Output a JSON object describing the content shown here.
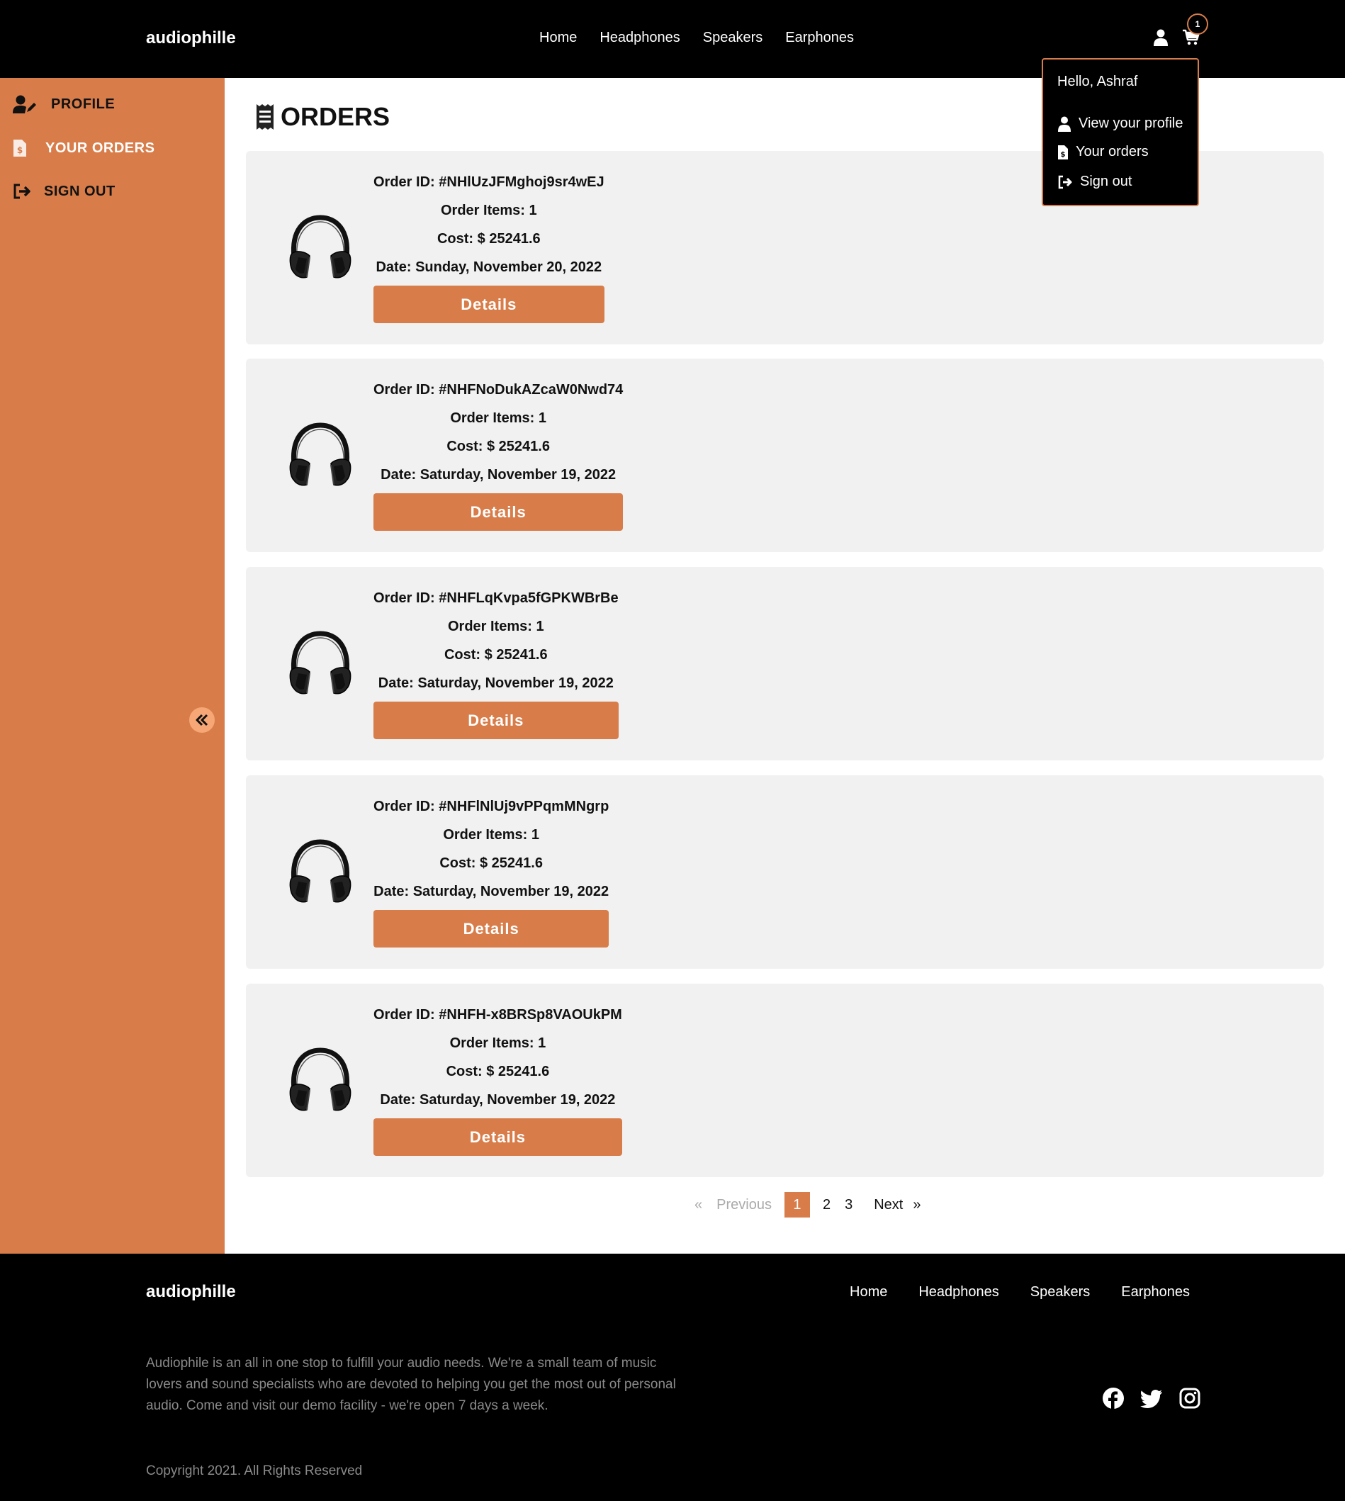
{
  "header": {
    "logo": "audiophille",
    "nav": [
      "Home",
      "Headphones",
      "Speakers",
      "Earphones"
    ],
    "cart_count": "1"
  },
  "dropdown": {
    "greeting": "Hello, Ashraf",
    "items": [
      "View your profile",
      "Your orders",
      "Sign out"
    ]
  },
  "sidebar": {
    "items": [
      "PROFILE",
      "YOUR ORDERS",
      "SIGN OUT"
    ]
  },
  "main": {
    "title": "ORDERS",
    "labels": {
      "order_id": "Order ID:",
      "order_items": "Order Items:",
      "cost": "Cost:",
      "date": "Date:",
      "details": "Details"
    },
    "orders": [
      {
        "id": "#NHlUzJFMghoj9sr4wEJ",
        "items": "1",
        "cost": "$ 25241.6",
        "date": "Sunday, November 20, 2022"
      },
      {
        "id": "#NHFNoDukAZcaW0Nwd74",
        "items": "1",
        "cost": "$ 25241.6",
        "date": "Saturday, November 19, 2022"
      },
      {
        "id": "#NHFLqKvpa5fGPKWBrBe",
        "items": "1",
        "cost": "$ 25241.6",
        "date": "Saturday, November 19, 2022"
      },
      {
        "id": "#NHFlNlUj9vPPqmMNgrp",
        "items": "1",
        "cost": "$ 25241.6",
        "date": "Saturday, November 19, 2022"
      },
      {
        "id": "#NHFH-x8BRSp8VAOUkPM",
        "items": "1",
        "cost": "$ 25241.6",
        "date": "Saturday, November 19, 2022"
      }
    ]
  },
  "pagination": {
    "prev_arrow": "«",
    "previous": "Previous",
    "pages": [
      "1",
      "2",
      "3"
    ],
    "current": "1",
    "next": "Next",
    "next_arrow": "»"
  },
  "footer": {
    "logo": "audiophille",
    "nav": [
      "Home",
      "Headphones",
      "Speakers",
      "Earphones"
    ],
    "description": "Audiophile is an all in one stop to fulfill your audio needs. We're a small team of music lovers and sound specialists who are devoted to helping you get the most out of personal audio. Come and visit our demo facility - we're open 7 days a week.",
    "copyright": "Copyright 2021. All Rights Reserved",
    "social": [
      "facebook-icon",
      "twitter-icon",
      "instagram-icon"
    ]
  },
  "colors": {
    "accent": "#d87d4a",
    "accent_light": "#f7a776",
    "card_bg": "#f1f1f1",
    "header_bg": "#000000"
  }
}
